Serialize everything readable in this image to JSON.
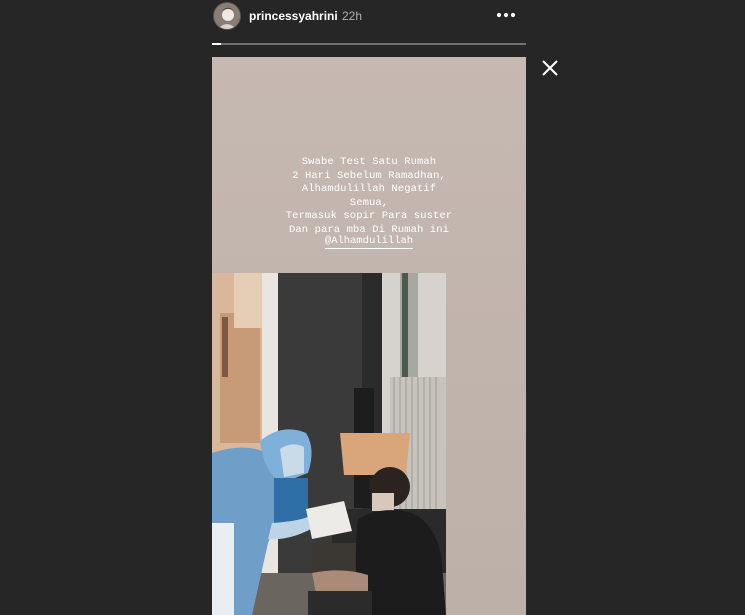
{
  "header": {
    "username": "princessyahrini",
    "timestamp": "22h"
  },
  "icons": {
    "more": "more-horizontal-icon",
    "close": "close-icon"
  },
  "story": {
    "progress_fraction": 0.03,
    "caption": "Swabe Test Satu Rumah\n2 Hari Sebelum Ramadhan,\nAlhamdulillah Negatif\nSemua,\nTermasuk sopir Para suster\nDan para mba Di Rumah ini",
    "mention": "@Alhamdulillah"
  }
}
